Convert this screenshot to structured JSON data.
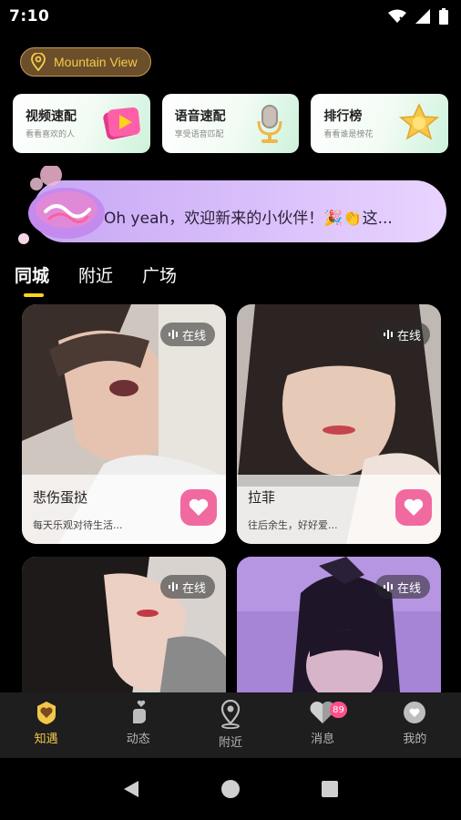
{
  "status_bar": {
    "time": "7:10"
  },
  "location": {
    "label": "Mountain View"
  },
  "features": [
    {
      "title": "视频速配",
      "subtitle": "看看喜欢的人"
    },
    {
      "title": "语音速配",
      "subtitle": "享受语音匹配"
    },
    {
      "title": "排行榜",
      "subtitle": "看看谁是榜花"
    }
  ],
  "banner": {
    "text": "Oh yeah，欢迎新来的小伙伴！🎉👏这..."
  },
  "tabs": [
    {
      "label": "同城",
      "active": true
    },
    {
      "label": "附近",
      "active": false
    },
    {
      "label": "广场",
      "active": false
    }
  ],
  "cards": [
    {
      "online": "在线",
      "name": "悲伤蛋挞",
      "bio": "每天乐观对待生活..."
    },
    {
      "online": "在线",
      "name": "拉菲",
      "bio": "往后余生，好好爱..."
    },
    {
      "online": "在线"
    },
    {
      "online": "在线"
    }
  ],
  "bottom_nav": [
    {
      "label": "知遇",
      "icon": "heart-badge-icon",
      "active": true
    },
    {
      "label": "动态",
      "icon": "finger-heart-icon",
      "active": false
    },
    {
      "label": "附近",
      "icon": "location-pin-icon",
      "active": false
    },
    {
      "label": "消息",
      "icon": "message-heart-icon",
      "active": false,
      "badge": "89"
    },
    {
      "label": "我的",
      "icon": "profile-icon",
      "active": false
    }
  ],
  "colors": {
    "accent": "#ffd21e",
    "location_text": "#f4cc4a",
    "like": "#f06aa0",
    "nav_active": "#f3c74a"
  }
}
